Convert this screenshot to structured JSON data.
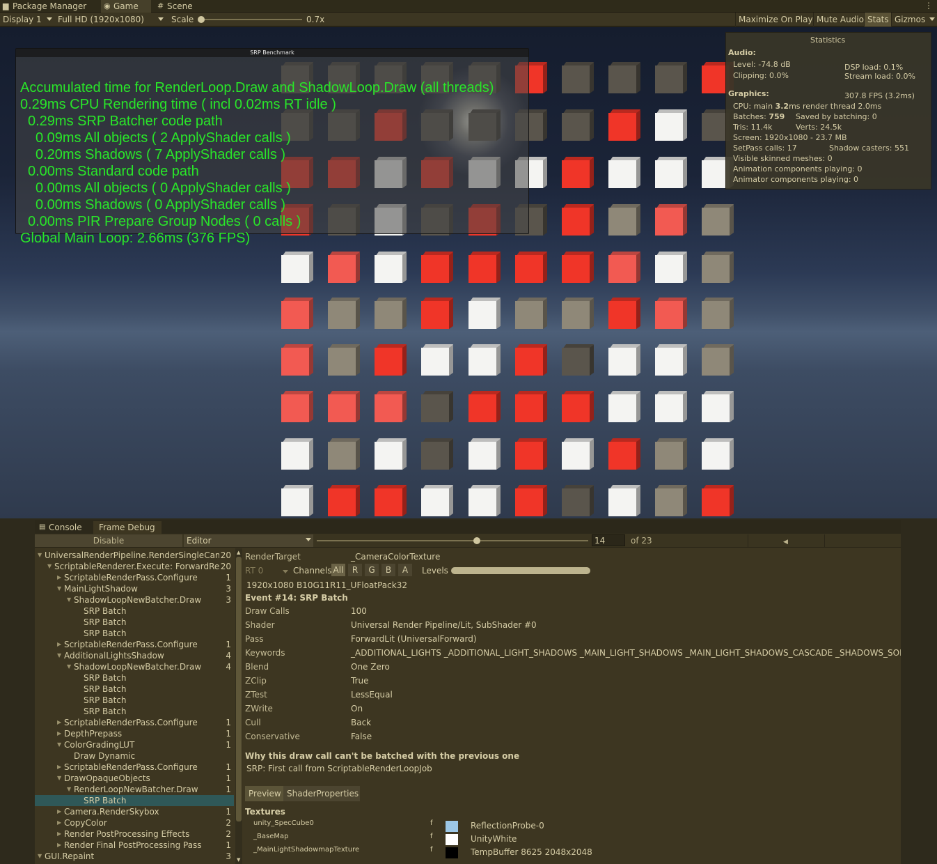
{
  "tabs": [
    {
      "label": "Package Manager",
      "icon": "package-icon",
      "glyph": "▆"
    },
    {
      "label": "Game",
      "icon": "gamepad-icon",
      "glyph": "◉"
    },
    {
      "label": "Scene",
      "icon": "scene-grid-icon",
      "glyph": "#"
    }
  ],
  "toolbar": {
    "display": "Display 1",
    "resolution": "Full HD (1920x1080)",
    "scale_label": "Scale",
    "scale_value": "0.7x",
    "maximize": "Maximize On Play",
    "mute": "Mute Audio",
    "stats": "Stats",
    "gizmos": "Gizmos"
  },
  "bench": {
    "title": "SRP Benchmark",
    "lines": [
      "Accumulated time for RenderLoop.Draw and ShadowLoop.Draw (all threads)",
      "0.29ms CPU Rendering time ( incl 0.02ms RT idle )",
      "0.29ms SRP Batcher code path",
      "0.09ms All objects ( 2 ApplyShader calls )",
      "0.20ms Shadows ( 7 ApplyShader calls )",
      "0.00ms Standard code path",
      "0.00ms All objects ( 0 ApplyShader calls )",
      "0.00ms Shadows ( 0 ApplyShader calls )",
      "0.00ms PIR Prepare Group Nodes ( 0 calls )",
      "Global Main Loop: 2.66ms (376 FPS)"
    ]
  },
  "stats": {
    "title": "Statistics",
    "audio_header": "Audio:",
    "level": "Level: -74.8 dB",
    "dsp": "DSP load: 0.1%",
    "clipping": "Clipping: 0.0%",
    "stream": "Stream load: 0.0%",
    "graphics_header": "Graphics:",
    "fps": "307.8 FPS (3.2ms)",
    "cpu_prefix": "CPU: main ",
    "cpu_main": "3.2",
    "cpu_suffix": "ms  render thread 2.0ms",
    "batches_prefix": "Batches: ",
    "batches": "759",
    "saved": "Saved by batching: 0",
    "tris": "Tris: 11.4k",
    "verts": "Verts: 24.5k",
    "screen": "Screen: 1920x1080 - 23.7 MB",
    "setpass": "SetPass calls: 17",
    "shadow_casters": "Shadow casters: 551",
    "skinned": "Visible skinned meshes: 0",
    "animation": "Animation components playing: 0",
    "animator": "Animator components playing: 0"
  },
  "cubes": {
    "colors": {
      "red": "#f03528",
      "white": "#f4f4f2",
      "gray": "#8f8878",
      "dark": "#5a554c",
      "pink": "#f25a52"
    },
    "rows": [
      [
        "dark",
        "dark",
        "dark",
        "dark",
        "dark",
        "red",
        "dark",
        "dark",
        "dark",
        "red"
      ],
      [
        "dark",
        "dark",
        "red",
        "dark",
        "dark",
        "dark",
        "dark",
        "red",
        "white",
        "dark"
      ],
      [
        "red",
        "red",
        "white",
        "red",
        "white",
        "white",
        "red",
        "white",
        "white",
        "white"
      ],
      [
        "red",
        "dark",
        "white",
        "dark",
        "red",
        "dark",
        "red",
        "gray",
        "pink",
        "gray"
      ],
      [
        "white",
        "pink",
        "white",
        "red",
        "red",
        "red",
        "red",
        "pink",
        "white",
        "gray"
      ],
      [
        "pink",
        "gray",
        "gray",
        "red",
        "white",
        "gray",
        "gray",
        "red",
        "pink",
        "gray"
      ],
      [
        "pink",
        "gray",
        "red",
        "white",
        "white",
        "red",
        "dark",
        "white",
        "white",
        "gray"
      ],
      [
        "pink",
        "pink",
        "pink",
        "dark",
        "red",
        "red",
        "red",
        "white",
        "white",
        "white"
      ],
      [
        "white",
        "gray",
        "white",
        "dark",
        "white",
        "red",
        "white",
        "red",
        "gray",
        "white"
      ],
      [
        "white",
        "red",
        "red",
        "white",
        "white",
        "red",
        "dark",
        "white",
        "gray",
        "red"
      ]
    ]
  },
  "frame_debug": {
    "tab_console": "Console",
    "tab_frame_debug": "Frame Debug",
    "disable": "Disable",
    "target": "Editor",
    "event_index": "14",
    "event_total": "of 23",
    "tree": [
      {
        "label": "UniversalRenderPipeline.RenderSingleCame",
        "count": "20",
        "depth": 0,
        "open": true
      },
      {
        "label": "ScriptableRenderer.Execute: ForwardRenc",
        "count": "20",
        "depth": 1,
        "open": true
      },
      {
        "label": "ScriptableRenderPass.Configure",
        "count": "1",
        "depth": 2,
        "open": false
      },
      {
        "label": "MainLightShadow",
        "count": "3",
        "depth": 2,
        "open": true
      },
      {
        "label": "ShadowLoopNewBatcher.Draw",
        "count": "3",
        "depth": 3,
        "open": true
      },
      {
        "label": "SRP Batch",
        "count": "",
        "depth": 4,
        "leaf": true
      },
      {
        "label": "SRP Batch",
        "count": "",
        "depth": 4,
        "leaf": true
      },
      {
        "label": "SRP Batch",
        "count": "",
        "depth": 4,
        "leaf": true
      },
      {
        "label": "ScriptableRenderPass.Configure",
        "count": "1",
        "depth": 2,
        "open": false
      },
      {
        "label": "AdditionalLightsShadow",
        "count": "4",
        "depth": 2,
        "open": true
      },
      {
        "label": "ShadowLoopNewBatcher.Draw",
        "count": "4",
        "depth": 3,
        "open": true
      },
      {
        "label": "SRP Batch",
        "count": "",
        "depth": 4,
        "leaf": true
      },
      {
        "label": "SRP Batch",
        "count": "",
        "depth": 4,
        "leaf": true
      },
      {
        "label": "SRP Batch",
        "count": "",
        "depth": 4,
        "leaf": true
      },
      {
        "label": "SRP Batch",
        "count": "",
        "depth": 4,
        "leaf": true
      },
      {
        "label": "ScriptableRenderPass.Configure",
        "count": "1",
        "depth": 2,
        "open": false
      },
      {
        "label": "DepthPrepass",
        "count": "1",
        "depth": 2,
        "open": false
      },
      {
        "label": "ColorGradingLUT",
        "count": "1",
        "depth": 2,
        "open": true
      },
      {
        "label": "Draw Dynamic",
        "count": "",
        "depth": 3,
        "leaf": true
      },
      {
        "label": "ScriptableRenderPass.Configure",
        "count": "1",
        "depth": 2,
        "open": false
      },
      {
        "label": "DrawOpaqueObjects",
        "count": "1",
        "depth": 2,
        "open": true
      },
      {
        "label": "RenderLoopNewBatcher.Draw",
        "count": "1",
        "depth": 3,
        "open": true
      },
      {
        "label": "SRP Batch",
        "count": "",
        "depth": 4,
        "leaf": true,
        "selected": true
      },
      {
        "label": "Camera.RenderSkybox",
        "count": "1",
        "depth": 2,
        "open": false
      },
      {
        "label": "CopyColor",
        "count": "2",
        "depth": 2,
        "open": false
      },
      {
        "label": "Render PostProcessing Effects",
        "count": "2",
        "depth": 2,
        "open": false
      },
      {
        "label": "Render Final PostProcessing Pass",
        "count": "1",
        "depth": 2,
        "open": false
      },
      {
        "label": "GUI.Repaint",
        "count": "3",
        "depth": 0,
        "open": true
      }
    ],
    "details": {
      "render_target_label": "RenderTarget",
      "render_target": "_CameraColorTexture",
      "rt": "RT 0",
      "channels": "Channels",
      "ch_all": "All",
      "ch_r": "R",
      "ch_g": "G",
      "ch_b": "B",
      "ch_a": "A",
      "levels": "Levels",
      "format": "1920x1080 B10G11R11_UFloatPack32",
      "event": "Event #14: SRP Batch",
      "props": [
        {
          "k": "Draw Calls",
          "v": "100"
        },
        {
          "k": "Shader",
          "v": "Universal Render Pipeline/Lit, SubShader #0"
        },
        {
          "k": "Pass",
          "v": "ForwardLit (UniversalForward)"
        },
        {
          "k": "Keywords",
          "v": "_ADDITIONAL_LIGHTS _ADDITIONAL_LIGHT_SHADOWS _MAIN_LIGHT_SHADOWS _MAIN_LIGHT_SHADOWS_CASCADE _SHADOWS_SOFT"
        },
        {
          "k": "Blend",
          "v": "One Zero"
        },
        {
          "k": "ZClip",
          "v": "True"
        },
        {
          "k": "ZTest",
          "v": "LessEqual"
        },
        {
          "k": "ZWrite",
          "v": "On"
        },
        {
          "k": "Cull",
          "v": "Back"
        },
        {
          "k": "Conservative",
          "v": "False"
        }
      ],
      "why_header": "Why this draw call can't be batched with the previous one",
      "why_text": "SRP: First call from ScriptableRenderLoopJob",
      "tab_preview": "Preview",
      "tab_shader_props": "ShaderProperties",
      "textures_header": "Textures",
      "textures": [
        {
          "name": "unity_SpecCube0",
          "flag": "f",
          "value": "ReflectionProbe-0",
          "swatch": "#9cc7e6"
        },
        {
          "name": "_BaseMap",
          "flag": "f",
          "value": "UnityWhite",
          "swatch": "#ffffff"
        },
        {
          "name": "_MainLightShadowmapTexture",
          "flag": "f",
          "value": "TempBuffer 8625 2048x2048",
          "swatch": "#000000"
        }
      ]
    }
  }
}
